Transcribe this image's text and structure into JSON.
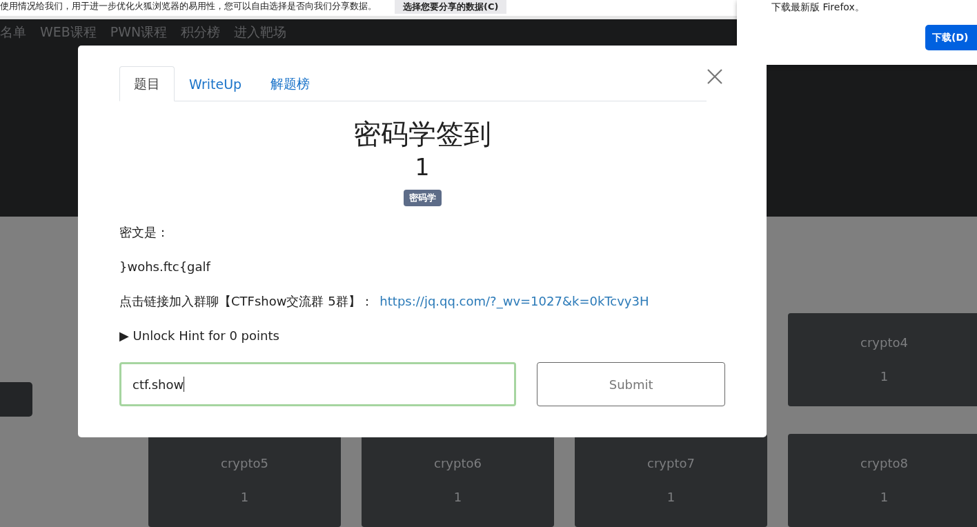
{
  "browser_notice": {
    "text": "使用情况给我们，用于进一步优化火狐浏览器的易用性，您可以自由选择是否向我们分享数据。",
    "button": "选择您要分享的数据(C)"
  },
  "update_popup": {
    "text": "下载最新版 Firefox。",
    "button": "下载(D)"
  },
  "nav": [
    "名单",
    "WEB课程",
    "PWN课程",
    "积分榜",
    "进入靶场"
  ],
  "challenge_cards": [
    {
      "name": "crypto4",
      "value": "1"
    },
    {
      "name": "crypto5",
      "value": "1"
    },
    {
      "name": "crypto6",
      "value": "1"
    },
    {
      "name": "crypto7",
      "value": "1"
    },
    {
      "name": "crypto8",
      "value": "1"
    }
  ],
  "modal": {
    "tabs": [
      {
        "label": "题目",
        "selected": true
      },
      {
        "label": "WriteUp",
        "selected": false
      },
      {
        "label": "解题榜",
        "selected": false
      }
    ],
    "title": "密码学签到",
    "value": "1",
    "tag": "密码学",
    "paragraphs": [
      {
        "text": "密文是："
      },
      {
        "text": "}wohs.ftc{galf"
      },
      {
        "text": "点击链接加入群聊【CTFshow交流群 5群】：",
        "link": "https://jq.qq.com/?_wv=1027&k=0kTcvy3H"
      }
    ],
    "hint": {
      "marker": "▶",
      "text": "Unlock Hint for 0 points"
    },
    "flag_input": {
      "value": "ctf.show",
      "focused": true
    },
    "submit": "Submit"
  }
}
